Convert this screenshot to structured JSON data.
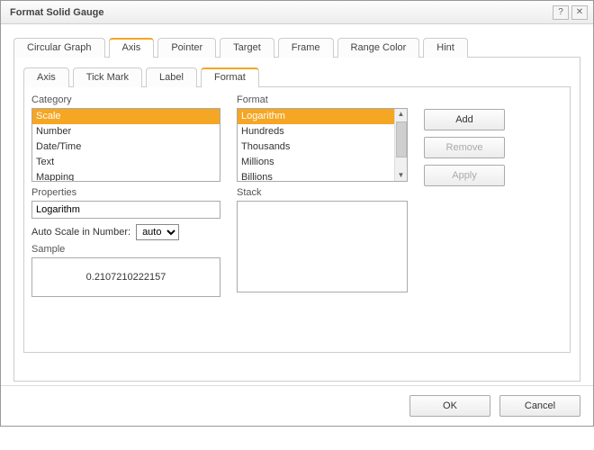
{
  "window": {
    "title": "Format Solid Gauge"
  },
  "outerTabs": [
    {
      "label": "Circular Graph"
    },
    {
      "label": "Axis"
    },
    {
      "label": "Pointer"
    },
    {
      "label": "Target"
    },
    {
      "label": "Frame"
    },
    {
      "label": "Range Color"
    },
    {
      "label": "Hint"
    }
  ],
  "innerTabs": [
    {
      "label": "Axis"
    },
    {
      "label": "Tick Mark"
    },
    {
      "label": "Label"
    },
    {
      "label": "Format"
    }
  ],
  "labels": {
    "category": "Category",
    "format": "Format",
    "properties": "Properties",
    "autoScale": "Auto Scale in Number:",
    "sample": "Sample",
    "stack": "Stack"
  },
  "categoryItems": [
    {
      "label": "Scale",
      "selected": true
    },
    {
      "label": "Number"
    },
    {
      "label": "Date/Time"
    },
    {
      "label": "Text"
    },
    {
      "label": "Mapping"
    }
  ],
  "formatItems": [
    {
      "label": "Logarithm",
      "selected": true
    },
    {
      "label": "Hundreds"
    },
    {
      "label": "Thousands"
    },
    {
      "label": "Millions"
    },
    {
      "label": "Billions"
    }
  ],
  "propertiesValue": "Logarithm",
  "autoScaleValue": "auto",
  "sampleValue": "0.2107210222157",
  "buttons": {
    "add": "Add",
    "remove": "Remove",
    "apply": "Apply",
    "ok": "OK",
    "cancel": "Cancel"
  }
}
